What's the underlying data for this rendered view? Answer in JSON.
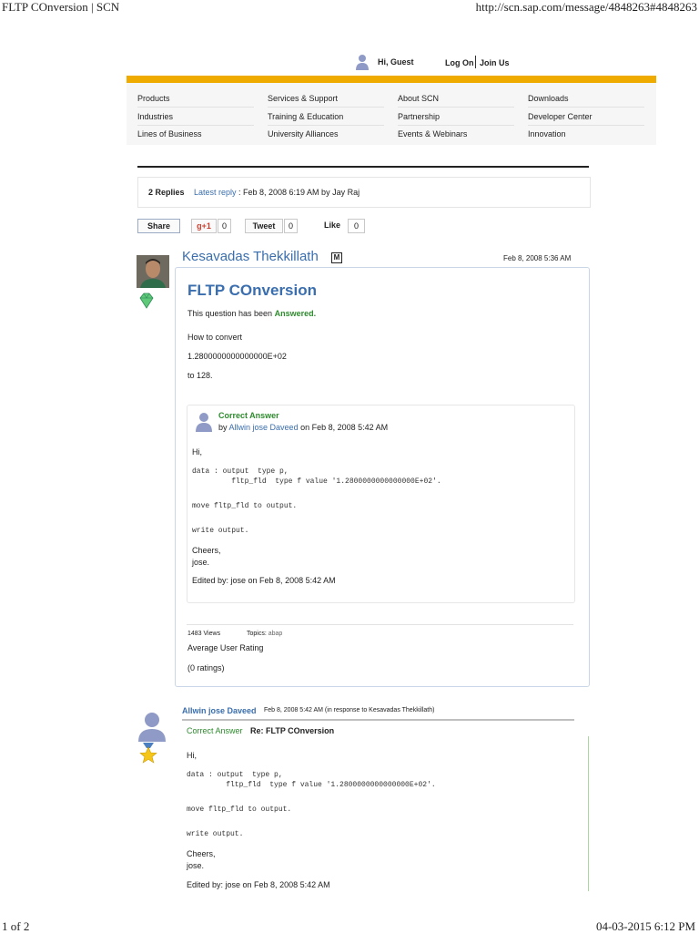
{
  "print": {
    "title": "FLTP COnversion | SCN",
    "url": "http://scn.sap.com/message/4848263#4848263",
    "page": "1 of 2",
    "datetime": "04-03-2015 6:12 PM"
  },
  "userbar": {
    "greeting": "Hi, Guest",
    "login": "Log On",
    "join": "Join Us"
  },
  "nav": {
    "accent": "#f0ab00",
    "columns": [
      [
        "Products",
        "Industries",
        "Lines of Business"
      ],
      [
        "Services & Support",
        "Training & Education",
        "University Alliances"
      ],
      [
        "About SCN",
        "Partnership",
        "Events & Webinars"
      ],
      [
        "Downloads",
        "Developer Center",
        "Innovation"
      ]
    ]
  },
  "replies": {
    "count": "2 Replies",
    "latest_label": "Latest reply",
    "latest_text": ": Feb 8, 2008 6:19 AM by Jay Raj"
  },
  "share": {
    "share_label": "Share",
    "gplus_label": "+1",
    "gplus_count": "0",
    "tweet_label": "Tweet",
    "tweet_count": "0",
    "like_label": "Like",
    "like_count": "0"
  },
  "question": {
    "author": "Kesavadas Thekkillath",
    "badge": "M",
    "date": "Feb 8, 2008 5:36 AM",
    "title": "FLTP COnversion",
    "status_prefix": "This question has been",
    "status_value": "Answered.",
    "body": [
      "How to convert",
      "1.2800000000000000E+02",
      "to 128."
    ],
    "correct_answer": {
      "label": "Correct Answer",
      "by_prefix": "by",
      "author": "Allwin jose Daveed",
      "date": "on Feb 8, 2008 5:42 AM",
      "greeting": "Hi,",
      "code1": "data : output  type p,\n         fltp_fld  type f value '1.2800000000000000E+02'.",
      "code2": "move fltp_fld to output.",
      "code3": "write output.",
      "closing1": "Cheers,",
      "closing2": "jose.",
      "edited": "Edited by: jose on Feb 8, 2008 5:42 AM"
    },
    "views": "1483 Views",
    "topics_label": "Topics:",
    "topics_value": "abap",
    "avg_rating": "Average User Rating",
    "ratings": "(0 ratings)"
  },
  "reply": {
    "author": "Allwin jose Daveed",
    "meta": "Feb 8, 2008 5:42 AM  (in response to Kesavadas Thekkillath)",
    "correct_label": "Correct Answer",
    "subject": "Re: FLTP COnversion",
    "greeting": "Hi,",
    "code1": "data : output  type p,\n         fltp_fld  type f value '1.2800000000000000E+02'.",
    "code2": "move fltp_fld to output.",
    "code3": "write output.",
    "closing1": "Cheers,",
    "closing2": "jose.",
    "edited": "Edited by: jose on Feb 8, 2008 5:42 AM"
  }
}
